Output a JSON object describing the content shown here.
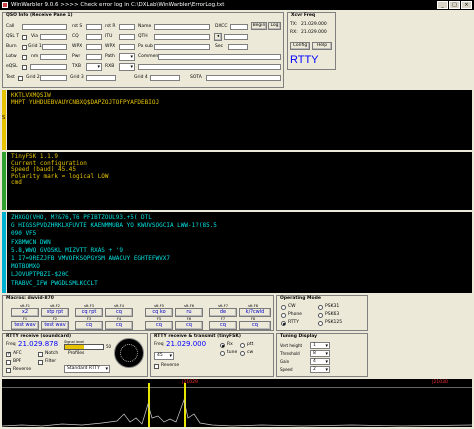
{
  "window": {
    "title": "WinWarbler 9.0.6 >>>> Check error log in C:\\DXLab\\WinWarbler\\ErrorLog.txt"
  },
  "qso": {
    "header": "QSO Info (Receive Pane 1)",
    "fields": {
      "call": "Call",
      "qsl": "QSL T",
      "burn": "Burn",
      "lotw": "Lotw",
      "eqsl": "eQSL",
      "test": "Test",
      "nm": "nm",
      "via": "Via",
      "grid1": "Grid 1",
      "grid2": "Grid 2",
      "rst": "rst S",
      "cq": "CQ",
      "wpx": "WPX",
      "pwr": "Pwr",
      "txb": "TXB",
      "grid3": "Grid 3",
      "rstr": "rst R",
      "itu": "ITU",
      "wpx2": "WPX",
      "path": "Path",
      "rxb": "RXB",
      "grid4": "Grid 4",
      "name": "Name",
      "qth": "QTH",
      "pxsub": "Px sub",
      "comment": "Comment",
      "contest": "Contest",
      "sota": "SOTA",
      "dxcc": "DXCC",
      "sec": "Sec"
    },
    "begin_btn": "Begin",
    "log_btn": "Log"
  },
  "xcvr": {
    "header": "Xcvr Freq",
    "tx_label": "TX:",
    "tx_freq": "21.029.000",
    "rx_label": "RX:",
    "rx_freq": "21.029.000",
    "config_btn": "Config",
    "help_btn": "Help",
    "mode": "RTTY"
  },
  "panes": {
    "side_label": "S",
    "transmit": [
      "KKTLVXMQSIW",
      "MHPT YUHDUEBVAUYCNBXQ$DAPZOJTOFPYAFDEBIOJ"
    ],
    "info": [
      "TinyFSK 1.1.9",
      "Current configuration",
      "  Speed (baud)  45.45",
      "  Polarity       mark = logical LOW",
      "",
      "cmd"
    ],
    "receive": [
      "ZHXGQ(VHO, M?&76,T6 PFIBTZOUL93.+5( DTL",
      "G HIGSSPVDZHRKLXFUVTE KAENMMUBA YO KWUVSOGCIA LWW-1?(85.5",
      "090 VF5",
      "FXBMWCN DWN",
      "5.8,WWQ GVOSKL MIZVTT RXAS + '9",
      "1 I7=9REZJFB VMVOFKSOPGYSM AWACUY EGHTEFWVX7",
      "MOTBOMXO",
      "LJOVUPTPBZI-$20C",
      "TRABVC_IFW PWGDLSMLKCCLT"
    ]
  },
  "macros": {
    "header": "Macros:  dwvid-870",
    "fkeys_top": [
      "sft-F1",
      "sft-F2",
      "sft-F3",
      "sft-F4",
      "sft-F5",
      "sft-F6",
      "sft-F7",
      "sft-F8"
    ],
    "row1": [
      "x2",
      "stp rpt",
      "cq rpt",
      "cq",
      "cq ko",
      "ru",
      "de",
      "k/?cwld"
    ],
    "fkeys_mid": [
      "F1",
      "F2",
      "F3",
      "F4",
      "F5",
      "F6",
      "F7",
      "F8"
    ],
    "row2": [
      "test wav",
      "test wav",
      "cq",
      "cq",
      "cq",
      "cq",
      "cq",
      "cq"
    ]
  },
  "operating_mode": {
    "header": "Operating Mode",
    "options": [
      "CW",
      "Phone",
      "RTTY",
      "PSK31",
      "PSK63",
      "PSK125"
    ],
    "selected": "RTTY"
  },
  "tuning": {
    "header": "Tuning Display",
    "labels": [
      "Vert height",
      "Threshold",
      "Gain",
      "Speed"
    ],
    "values": [
      "1",
      "8",
      "4",
      "2"
    ]
  },
  "rtty_rx": {
    "header": "RTTY receive (soundcard)",
    "freq_label": "Freq",
    "freq": "21.029.878",
    "afc": "AFC",
    "notch": "Notch",
    "bpf": "BPF",
    "filter": "Filter",
    "reverse": "Reverse",
    "profiles": "Profiles",
    "profile_val": "Standard RTTY",
    "level_label": "Signal level",
    "level_value": "50"
  },
  "rtty_tx": {
    "header": "RTTY receive & transmit (tinyFSK)",
    "freq_label": "Freq",
    "freq": "21.029.000",
    "rx_lbl": "Rx",
    "ptt": "ptt",
    "tune": "tune",
    "cw": "cw",
    "reverse": "Reverse",
    "speed_val": "45"
  },
  "waterfall": {
    "mark_left": "|21029",
    "mark_right": "|21030"
  },
  "colors": {
    "pane_text": "#e6c200",
    "receive_text": "#00e0e0",
    "rtty": "#0000ff",
    "info_text": "#e6c200"
  }
}
